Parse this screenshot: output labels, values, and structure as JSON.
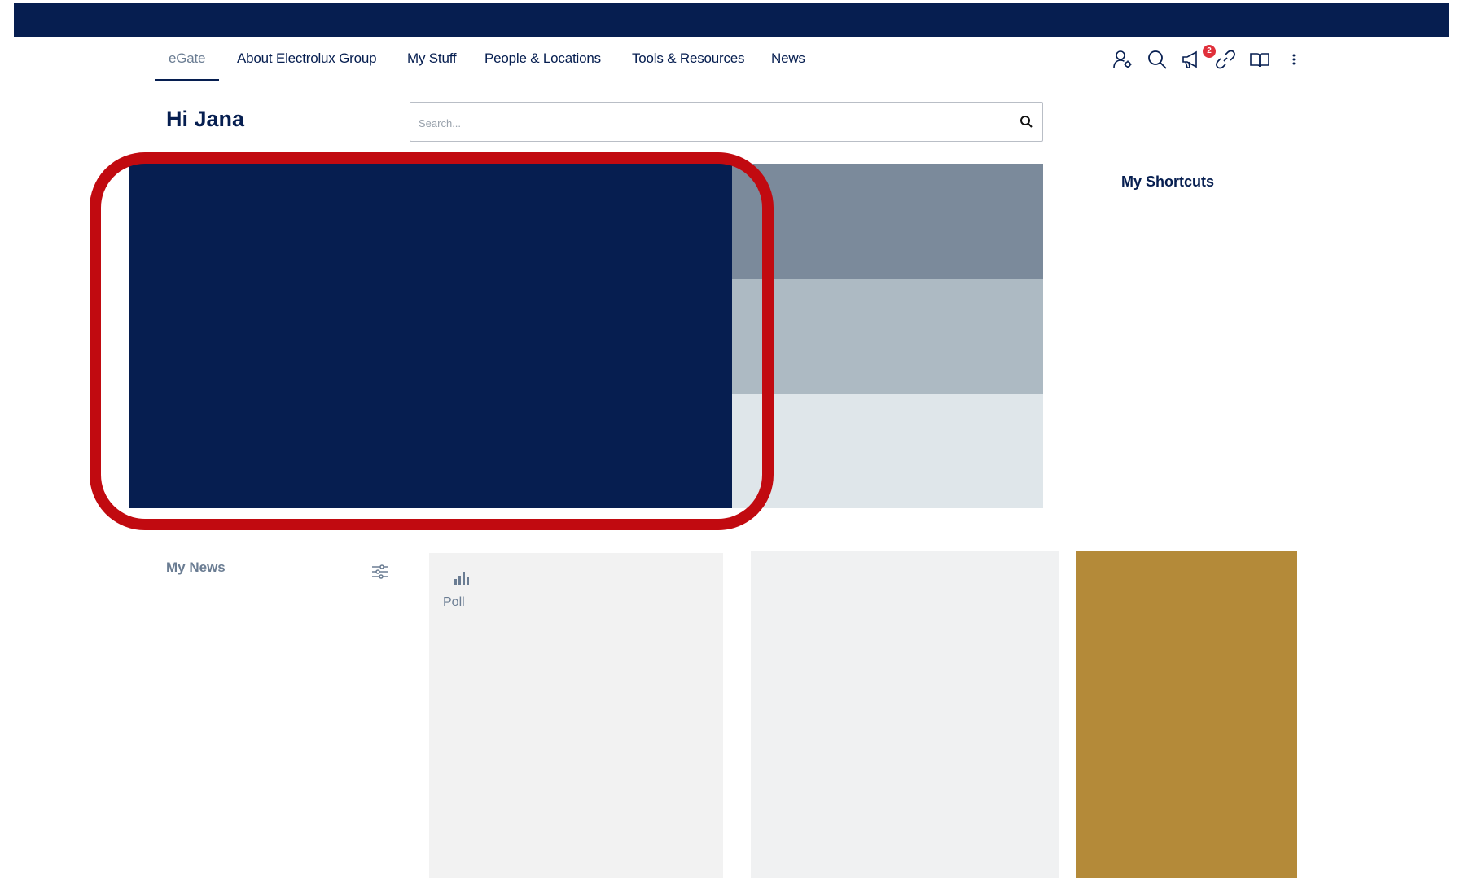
{
  "nav": {
    "items": [
      {
        "label": "eGate",
        "active": true
      },
      {
        "label": "About Electrolux Group",
        "active": false
      },
      {
        "label": "My Stuff",
        "active": false
      },
      {
        "label": "People & Locations",
        "active": false
      },
      {
        "label": "Tools & Resources",
        "active": false
      },
      {
        "label": "News",
        "active": false
      }
    ],
    "icons": [
      "user-settings-icon",
      "search-icon",
      "megaphone-icon",
      "link-icon",
      "book-icon",
      "more-vertical-icon"
    ],
    "notification_count": "2"
  },
  "header": {
    "greeting": "Hi Jana"
  },
  "search": {
    "placeholder": "Search...",
    "value": ""
  },
  "shortcuts": {
    "title": "My Shortcuts"
  },
  "news": {
    "title": "My News",
    "poll_label": "Poll"
  },
  "colors": {
    "brand_navy": "#061e50",
    "highlight_red": "#c10a10",
    "badge_red": "#e0303b",
    "gold": "#b48a39",
    "muted_text": "#6b7d93"
  }
}
